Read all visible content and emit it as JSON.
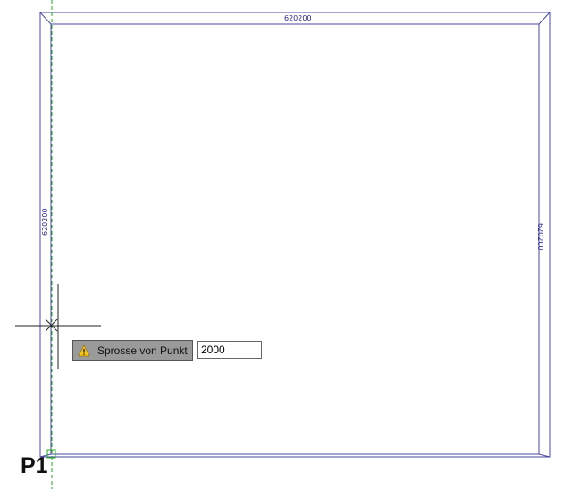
{
  "drawing": {
    "dimension_top": "620200",
    "dimension_left": "620200",
    "dimension_right": "620200",
    "frame_color": "#4a4aa0",
    "guide_color": "#22aa22"
  },
  "prompt": {
    "label": "Sprosse von Punkt",
    "icon": "warning-icon",
    "input_value": "2000"
  },
  "point_marker": {
    "label": "P1"
  }
}
